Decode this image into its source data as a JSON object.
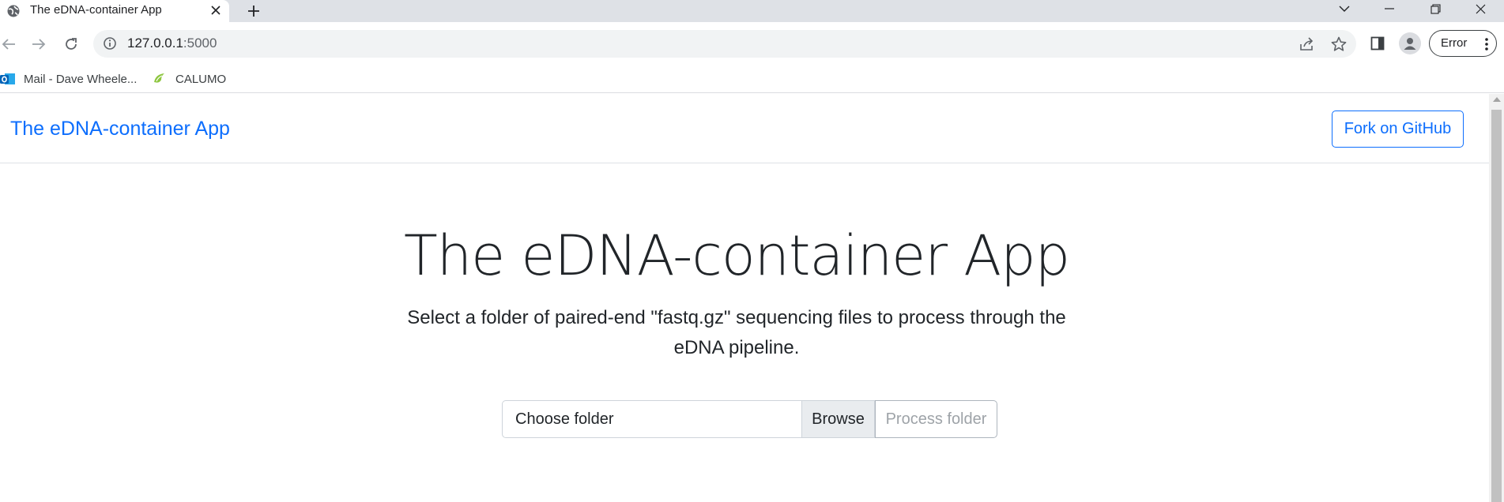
{
  "browser": {
    "tab_title": "The eDNA-container App",
    "url_host": "127.0.0.1",
    "url_port": ":5000",
    "profile_status": "Error",
    "bookmarks": [
      {
        "label": "Mail - Dave Wheele..."
      },
      {
        "label": "CALUMO"
      }
    ]
  },
  "navbar": {
    "brand": "The eDNA-container App",
    "fork_label": "Fork on GitHub"
  },
  "hero": {
    "title": "The eDNA-container App",
    "lead": "Select a folder of paired-end \"fastq.gz\" sequencing files to process through the eDNA pipeline."
  },
  "upload": {
    "placeholder": "Choose folder",
    "browse_label": "Browse",
    "process_label": "Process folder"
  },
  "colors": {
    "primary": "#0d6efd",
    "tabstrip": "#dee1e6",
    "omnibox": "#f1f3f4"
  }
}
